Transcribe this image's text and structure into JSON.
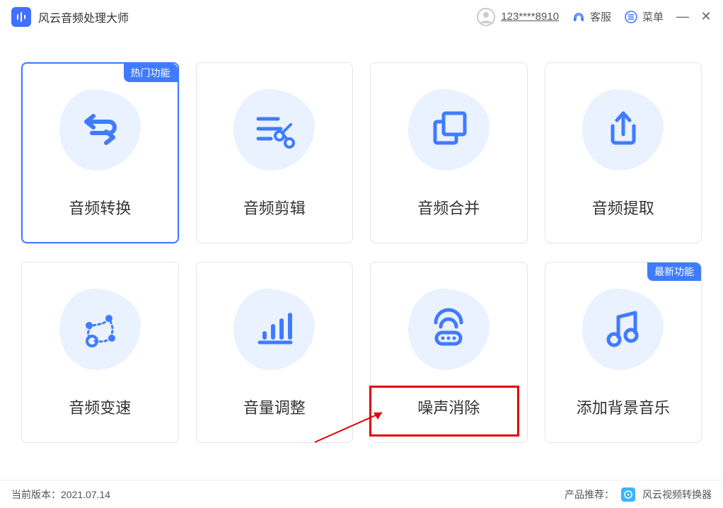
{
  "titlebar": {
    "app_title": "风云音频处理大师",
    "user_name": "123****8910",
    "support_label": "客服",
    "menu_label": "菜单"
  },
  "badges": {
    "hot": "热门功能",
    "new": "最新功能"
  },
  "cards": [
    {
      "label": "音频转换"
    },
    {
      "label": "音频剪辑"
    },
    {
      "label": "音频合并"
    },
    {
      "label": "音频提取"
    },
    {
      "label": "音频变速"
    },
    {
      "label": "音量调整"
    },
    {
      "label": "噪声消除"
    },
    {
      "label": "添加背景音乐"
    }
  ],
  "footer": {
    "version_prefix": "当前版本：",
    "version": "2021.07.14",
    "recommend_prefix": "产品推荐：",
    "recommend_product": "风云视频转换器"
  }
}
